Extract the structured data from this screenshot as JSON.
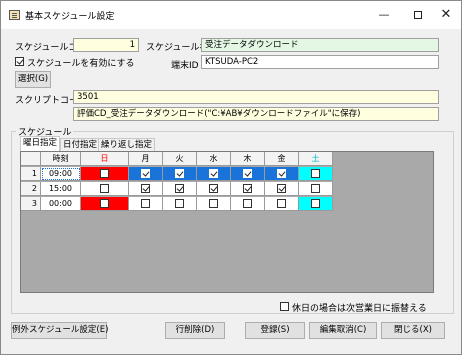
{
  "window": {
    "title": "基本スケジュール設定",
    "minimize_glyph": "—",
    "close_glyph": "✕"
  },
  "form": {
    "schedule_code_label": "スケジュールコード",
    "schedule_code_value": "1",
    "schedule_name_label": "スケジュール名",
    "schedule_name_value": "受注データダウンロード",
    "enable_label": "スケジュールを有効にする",
    "enable_checked": true,
    "terminal_id_label": "端末ID",
    "terminal_id_value": "KTSUDA-PC2",
    "select_button": "選択(G)",
    "script_code_label": "スクリプトコード",
    "script_code_value": "3501",
    "script_desc_value": "評価CD_受注データダウンロード(\"C:¥AB¥ダウンロードファイル\"に保存)"
  },
  "schedule": {
    "group_label": "スケジュール",
    "tabs": [
      "曜日指定",
      "日付指定",
      "繰り返し指定"
    ],
    "active_tab": 0,
    "columns": [
      "時刻",
      "日",
      "月",
      "火",
      "水",
      "木",
      "金",
      "土"
    ],
    "rows": [
      {
        "no": "1",
        "time": "09:00",
        "days": [
          false,
          true,
          true,
          true,
          true,
          true,
          false
        ]
      },
      {
        "no": "2",
        "time": "15:00",
        "days": [
          false,
          true,
          true,
          true,
          true,
          true,
          false
        ]
      },
      {
        "no": "3",
        "time": "00:00",
        "days": [
          false,
          false,
          false,
          false,
          false,
          false,
          false
        ]
      }
    ],
    "selected_row": 0
  },
  "holiday_option": {
    "label": "休日の場合は次営業日に振替える",
    "checked": false
  },
  "buttons": {
    "exception": "例外スケジュール設定(E)",
    "delete_row": "行削除(D)",
    "register": "登録(S)",
    "cancel_edit": "編集取消(C)",
    "close": "閉じる(X)"
  },
  "colors": {
    "sunday": "#ff0000",
    "saturday": "#00ffff",
    "selected_row": "#1a73d9",
    "sunday_header_text": "#ff0000",
    "saturday_header_text": "#00b0d0"
  }
}
